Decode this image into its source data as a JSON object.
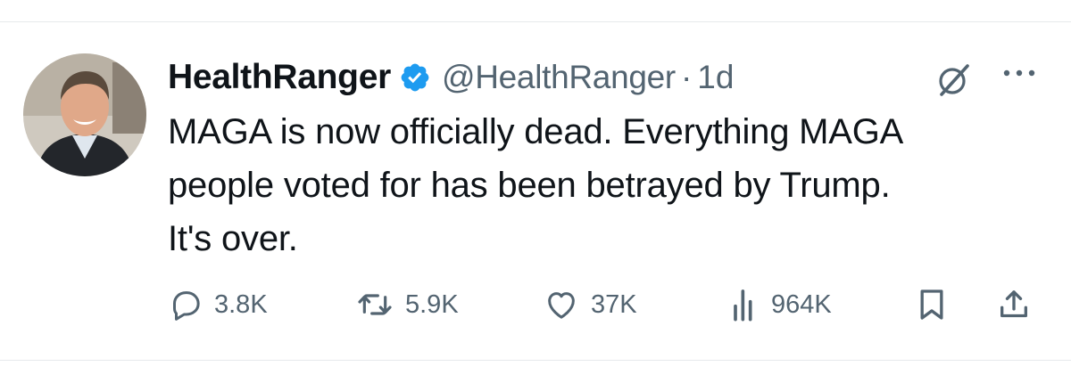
{
  "author": {
    "display_name": "HealthRanger",
    "handle": "@HealthRanger",
    "separator": "·",
    "time": "1d",
    "verified": true,
    "badge_color": "#1d9bf0"
  },
  "tweet": {
    "text": "MAGA is now officially dead. Everything MAGA\npeople voted for has been betrayed by Trump.\nIt's over."
  },
  "actions": {
    "reply_count": "3.8K",
    "retweet_count": "5.9K",
    "like_count": "37K",
    "view_count": "964K"
  },
  "icons": {
    "header": [
      "grok-icon",
      "more-icon"
    ],
    "actions": [
      "reply-icon",
      "retweet-icon",
      "like-icon",
      "views-icon",
      "bookmark-icon",
      "share-icon"
    ]
  },
  "colors": {
    "text_primary": "#0f1419",
    "text_secondary": "#536471",
    "verified": "#1d9bf0"
  }
}
